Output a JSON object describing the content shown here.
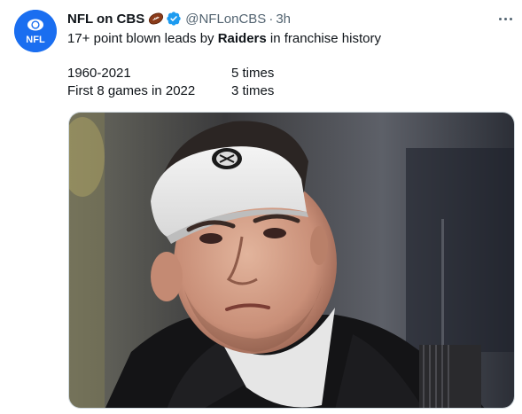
{
  "author": {
    "display_name": "NFL on CBS",
    "emoji_icon": "football-icon",
    "verified": true,
    "handle": "@NFLonCBS",
    "separator": "·",
    "time": "3h",
    "avatar_text": "NFL",
    "avatar_color": "#1a6ef0"
  },
  "tweet": {
    "text_before": "17+ point blown leads by ",
    "text_bold": "Raiders",
    "text_after": " in franchise history",
    "stats": [
      {
        "label": "1960-2021",
        "value": "5 times"
      },
      {
        "label": "First 8 games in 2022",
        "value": "3 times"
      }
    ]
  },
  "media": {
    "icon": "coach-photo"
  },
  "colors": {
    "text": "#0f1419",
    "secondary": "#536471",
    "verified": "#1d9bf0"
  }
}
